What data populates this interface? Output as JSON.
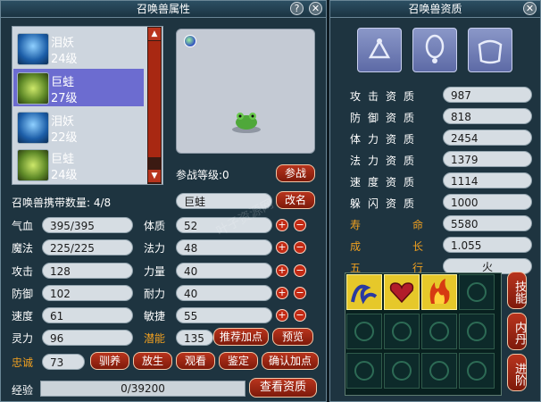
{
  "left_panel": {
    "title": "召唤兽属性",
    "help_label": "?",
    "close_label": "✕",
    "pets": [
      {
        "name": "泪妖",
        "level": "24级"
      },
      {
        "name": "巨蛙",
        "level": "27级"
      },
      {
        "name": "泪妖",
        "level": "22级"
      },
      {
        "name": "巨蛙",
        "level": "24级"
      }
    ],
    "battle_level": "参战等级:0",
    "battle_button": "参战",
    "carry_count": "召唤兽携带数量: 4/8",
    "pet_name_value": "巨蛙",
    "rename_button": "改名",
    "stats_left": [
      {
        "label": "气血",
        "value": "395/395"
      },
      {
        "label": "魔法",
        "value": "225/225"
      },
      {
        "label": "攻击",
        "value": "128"
      },
      {
        "label": "防御",
        "value": "102"
      },
      {
        "label": "速度",
        "value": "61"
      },
      {
        "label": "灵力",
        "value": "96"
      }
    ],
    "stats_right": [
      {
        "label": "体质",
        "value": "52"
      },
      {
        "label": "法力",
        "value": "48"
      },
      {
        "label": "力量",
        "value": "40"
      },
      {
        "label": "耐力",
        "value": "40"
      },
      {
        "label": "敏捷",
        "value": "55"
      }
    ],
    "potential_label": "潜能",
    "potential_value": "135",
    "recommend_button": "推荐加点",
    "preview_button": "预览",
    "loyalty_label": "忠诚",
    "loyalty_value": "73",
    "action_buttons": [
      "驯养",
      "放生",
      "观看",
      "鉴定",
      "确认加点"
    ],
    "exp_label": "经验",
    "exp_value": "0/39200",
    "exp_fraction": 0,
    "view_qualification_button": "查看资质"
  },
  "right_panel": {
    "title": "召唤兽资质",
    "close_label": "✕",
    "qualifications": [
      {
        "label": "攻击资质",
        "value": "987"
      },
      {
        "label": "防御资质",
        "value": "818"
      },
      {
        "label": "体力资质",
        "value": "2454"
      },
      {
        "label": "法力资质",
        "value": "1379"
      },
      {
        "label": "速度资质",
        "value": "1114"
      },
      {
        "label": "躲闪资质",
        "value": "1000"
      }
    ],
    "lifespan_label": "寿命",
    "lifespan_value": "5580",
    "growth_label": "成长",
    "growth_value": "1.055",
    "element_label": "五行",
    "element_value": "火",
    "side_buttons": [
      "技能",
      "内丹",
      "进阶"
    ],
    "equipment_slots": [
      "helmet-slot-icon",
      "necklace-slot-icon",
      "armor-slot-icon"
    ],
    "skills": [
      "skill-icon-1",
      "skill-icon-2",
      "skill-icon-3"
    ]
  },
  "watermark": "叶子资源网",
  "colors": {
    "panel_bg": "#1e3440",
    "field_bg": "#d6dde3",
    "button_red": "#b8341d",
    "accent_orange": "#f0a020",
    "skill_gold": "#e6c82a"
  }
}
